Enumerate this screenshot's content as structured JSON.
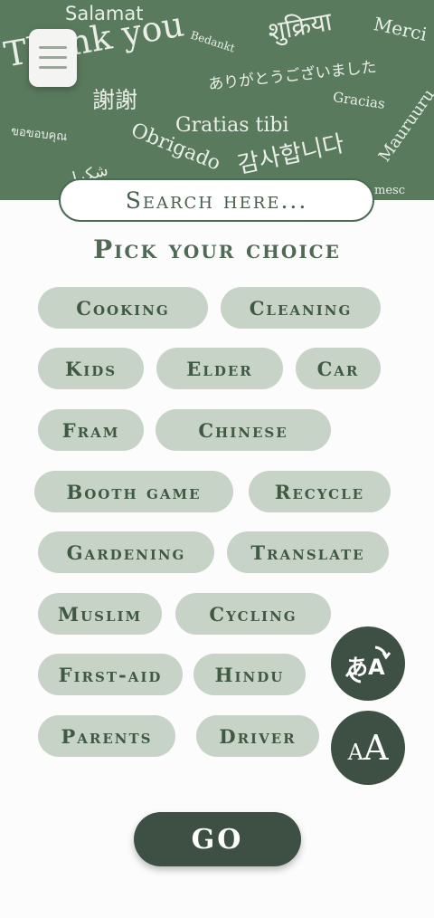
{
  "hero_words": [
    "Salamat",
    "Thank you",
    "शुक्रिया",
    "Merci",
    "Bedankt",
    "謝謝",
    "ありがとうございました",
    "Gracias",
    "Gratias tibi",
    "ขอขอบคุณ",
    "Obrigado",
    "감사합니다",
    "Mauruuru",
    "شكرا",
    "mesc"
  ],
  "search": {
    "placeholder": "Search here..."
  },
  "page_title": "Pick your choice",
  "chips": [
    "Cooking",
    "Cleaning",
    "Kids",
    "Elder",
    "Car",
    "Fram",
    "Chinese",
    "Booth game",
    "Recycle",
    "Gardening",
    "Translate",
    "Muslim",
    "Cycling",
    "First-aid",
    "Hindu",
    "Parents",
    "Driver"
  ],
  "buttons": {
    "go_label": "GO",
    "font_size_label": "AA",
    "translate_label": "あA"
  },
  "colors": {
    "hero_bg": "#5a7a5e",
    "chip_bg": "#c7d3c6",
    "dark_green": "#3d5043",
    "text_green": "#4e6a54"
  },
  "icons": {
    "menu": "hamburger-menu-icon",
    "translate": "translate-icon",
    "font_size": "font-size-icon"
  }
}
